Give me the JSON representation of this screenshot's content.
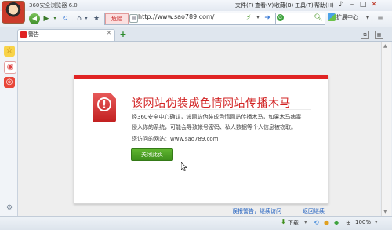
{
  "window": {
    "title": "360安全浏览器 6.0",
    "menu": [
      "文件(F)",
      "查看(V)",
      "收藏(B)",
      "工具(T)",
      "帮助(H)"
    ]
  },
  "toolbar": {
    "danger_badge": "危险",
    "url": "http://www.sao789.com/",
    "extension_center": "扩展中心"
  },
  "tab": {
    "label": "警告"
  },
  "warning": {
    "title": "该网站伪装成色情网站传播木马",
    "body_lines": [
      "经360安全中心确认，该网站伪装成色情网站传播木马，如果木马病毒",
      "侵入你的系统，可能会导致帐号密码、私人数据等个人信息被窃取。"
    ],
    "visited_label": "您访问的网站：www.sao789.com",
    "close_button": "关闭此页"
  },
  "footer": {
    "report_link": "误报警告，继续访问",
    "return_link": "返回继续"
  },
  "statusbar": {
    "download": "下载",
    "zoom": "100%"
  },
  "colors": {
    "danger": "#e02424",
    "button_green": "#4ea325",
    "link": "#1f5fbf"
  }
}
